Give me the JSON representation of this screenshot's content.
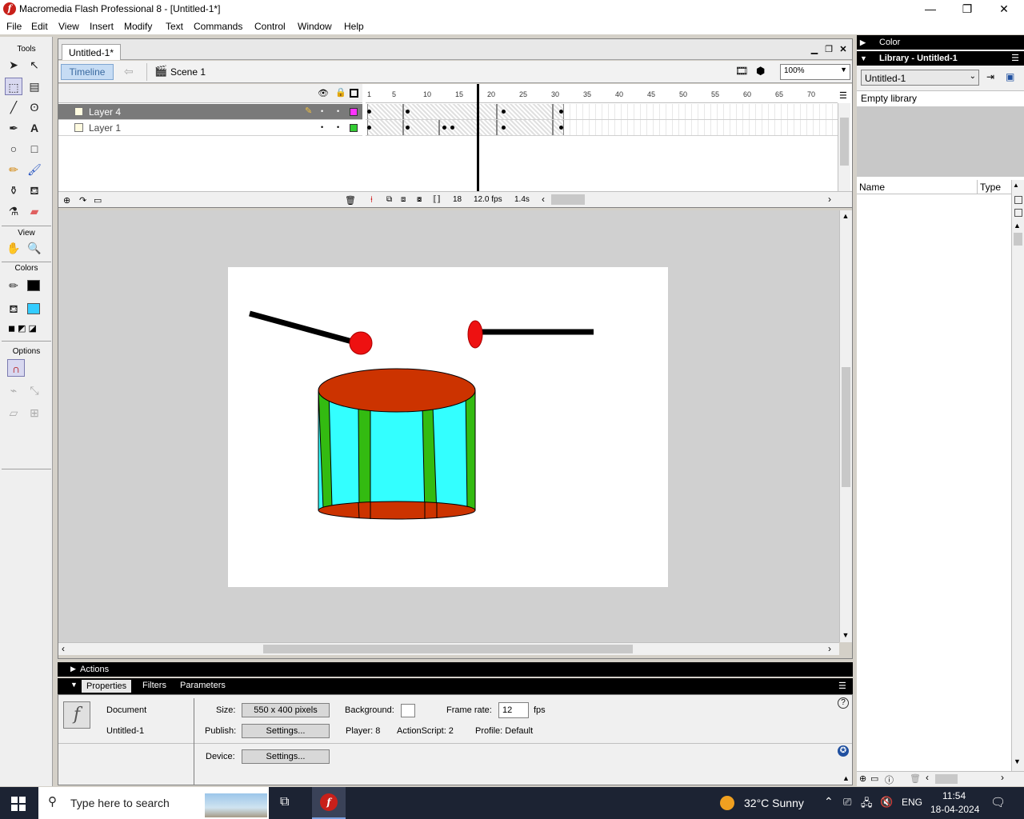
{
  "window": {
    "title": "Macromedia Flash Professional 8 - [Untitled-1*]",
    "minimize": "—",
    "maximize": "❐",
    "close": "✕"
  },
  "menu": [
    "File",
    "Edit",
    "View",
    "Insert",
    "Modify",
    "Text",
    "Commands",
    "Control",
    "Window",
    "Help"
  ],
  "tools": {
    "header": "Tools",
    "view_header": "View",
    "colors_header": "Colors",
    "options_header": "Options",
    "stroke_color": "#000000",
    "fill_color": "#33ccff"
  },
  "document": {
    "tab": "Untitled-1*",
    "timeline_button": "Timeline",
    "scene": "Scene 1",
    "zoom": "100%"
  },
  "timeline": {
    "ruler": [
      "1",
      "5",
      "10",
      "15",
      "20",
      "25",
      "30",
      "35",
      "40",
      "45",
      "50",
      "55",
      "60",
      "65",
      "70"
    ],
    "layers": [
      {
        "name": "Layer 4",
        "color": "#ff33ff",
        "active": true
      },
      {
        "name": "Layer 1",
        "color": "#33cc33",
        "active": false
      }
    ],
    "current_frame": "18",
    "fps": "12.0 fps",
    "elapsed": "1.4s"
  },
  "stage": {
    "background": "#ffffff",
    "drum_top": "#cc3300",
    "drum_body": "#33ffff",
    "drum_stripe": "#33bb11",
    "stick_head": "#ee1111"
  },
  "panels": {
    "actions": "Actions",
    "tabs": [
      "Properties",
      "Filters",
      "Parameters"
    ],
    "doc_label": "Document",
    "doc_name": "Untitled-1",
    "size_label": "Size:",
    "size_value": "550 x 400 pixels",
    "background_label": "Background:",
    "framerate_label": "Frame rate:",
    "framerate_value": "12",
    "fps_unit": "fps",
    "publish_label": "Publish:",
    "settings_btn": "Settings...",
    "player": "Player: 8",
    "actionscript": "ActionScript:  2",
    "profile": "Profile:  Default",
    "device_label": "Device:"
  },
  "right": {
    "color": "Color",
    "library": "Library - Untitled-1",
    "library_select": "Untitled-1",
    "empty": "Empty library",
    "col_name": "Name",
    "col_type": "Type"
  },
  "taskbar": {
    "search": "Type here to search",
    "weather": "32°C  Sunny",
    "lang": "ENG",
    "time": "11:54",
    "date": "18-04-2024"
  }
}
